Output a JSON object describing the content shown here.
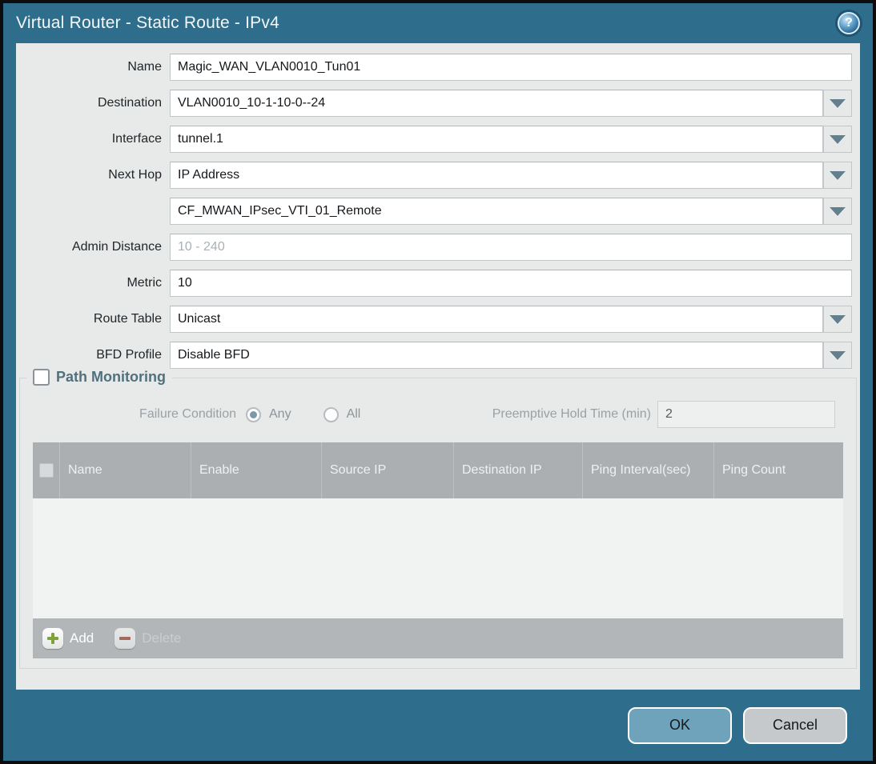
{
  "title": "Virtual Router - Static Route - IPv4",
  "help_icon_glyph": "?",
  "form": {
    "name": {
      "label": "Name",
      "value": "Magic_WAN_VLAN0010_Tun01"
    },
    "destination": {
      "label": "Destination",
      "value": "VLAN0010_10-1-10-0--24"
    },
    "interface": {
      "label": "Interface",
      "value": "tunnel.1"
    },
    "next_hop": {
      "label": "Next Hop",
      "value": "IP Address"
    },
    "next_hop_address": {
      "value": "CF_MWAN_IPsec_VTI_01_Remote"
    },
    "admin_distance": {
      "label": "Admin Distance",
      "placeholder": "10 - 240"
    },
    "metric": {
      "label": "Metric",
      "value": "10"
    },
    "route_table": {
      "label": "Route Table",
      "value": "Unicast"
    },
    "bfd_profile": {
      "label": "BFD Profile",
      "value": "Disable BFD"
    }
  },
  "path_monitoring": {
    "title": "Path Monitoring",
    "checkbox_checked": false,
    "failure_condition_label": "Failure Condition",
    "options": [
      "Any",
      "All"
    ],
    "selected_option": "Any",
    "preemptive_label": "Preemptive Hold Time (min)",
    "preemptive_value": "2",
    "table": {
      "columns": [
        "Name",
        "Enable",
        "Source IP",
        "Destination IP",
        "Ping Interval(sec)",
        "Ping Count"
      ],
      "rows": []
    },
    "add_label": "Add",
    "delete_label": "Delete"
  },
  "footer": {
    "ok_label": "OK",
    "cancel_label": "Cancel"
  },
  "colors": {
    "titlebar_teal": "#2e6d8c",
    "content_bg": "#e8e9e9",
    "table_header_bg": "#abafb2",
    "ok_button": "#6fa2bb",
    "cancel_button": "#c6c9cc",
    "add_plus_green": "#7fa33a",
    "delete_minus_red": "#a4685c",
    "pm_title": "#50707e"
  }
}
